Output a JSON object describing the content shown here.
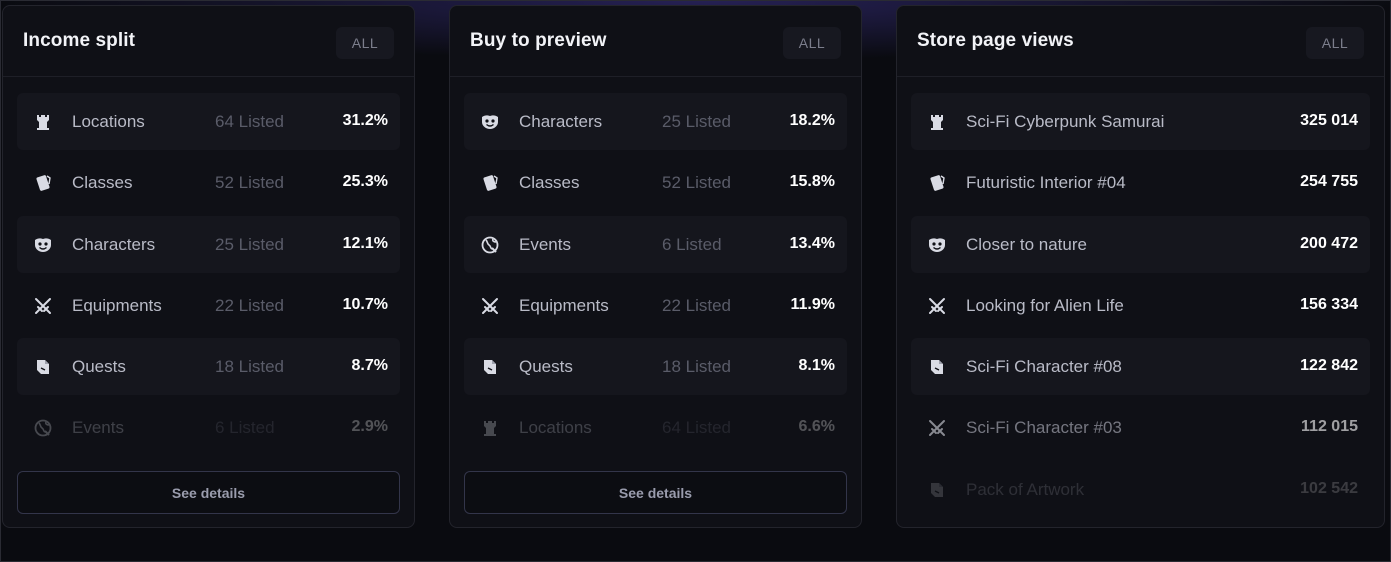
{
  "panels": [
    {
      "title": "Income split",
      "filter_label": "ALL",
      "details_label": "See details",
      "rows": [
        {
          "icon": "tower-icon",
          "name": "Locations",
          "listed": "64 Listed",
          "value": "31.2%"
        },
        {
          "icon": "card-icon",
          "name": "Classes",
          "listed": "52 Listed",
          "value": "25.3%"
        },
        {
          "icon": "mask-icon",
          "name": "Characters",
          "listed": "25 Listed",
          "value": "12.1%"
        },
        {
          "icon": "swords-icon",
          "name": "Equipments",
          "listed": "22 Listed",
          "value": "10.7%"
        },
        {
          "icon": "scroll-icon",
          "name": "Quests",
          "listed": "18 Listed",
          "value": "8.7%"
        },
        {
          "icon": "globe-icon",
          "name": "Events",
          "listed": "6 Listed",
          "value": "2.9%"
        }
      ]
    },
    {
      "title": "Buy to preview",
      "filter_label": "ALL",
      "details_label": "See details",
      "rows": [
        {
          "icon": "mask-icon",
          "name": "Characters",
          "listed": "25 Listed",
          "value": "18.2%"
        },
        {
          "icon": "card-icon",
          "name": "Classes",
          "listed": "52 Listed",
          "value": "15.8%"
        },
        {
          "icon": "globe-icon",
          "name": "Events",
          "listed": "6 Listed",
          "value": "13.4%"
        },
        {
          "icon": "swords-icon",
          "name": "Equipments",
          "listed": "22 Listed",
          "value": "11.9%"
        },
        {
          "icon": "scroll-icon",
          "name": "Quests",
          "listed": "18 Listed",
          "value": "8.1%"
        },
        {
          "icon": "tower-icon",
          "name": "Locations",
          "listed": "64 Listed",
          "value": "6.6%"
        }
      ]
    },
    {
      "title": "Store page views",
      "filter_label": "ALL",
      "rows": [
        {
          "icon": "tower-icon",
          "name": "Sci-Fi Cyberpunk Samurai",
          "value": "325 014"
        },
        {
          "icon": "card-icon",
          "name": "Futuristic Interior #04",
          "value": "254 755"
        },
        {
          "icon": "mask-icon",
          "name": "Closer to nature",
          "value": "200 472"
        },
        {
          "icon": "swords-icon",
          "name": "Looking for Alien Life",
          "value": "156 334"
        },
        {
          "icon": "scroll-icon",
          "name": "Sci-Fi Character #08",
          "value": "122 842"
        },
        {
          "icon": "swords-icon",
          "name": "Sci-Fi Character #03",
          "value": "112 015"
        },
        {
          "icon": "scroll-icon",
          "name": "Pack of Artwork",
          "value": "102 542"
        }
      ]
    }
  ]
}
